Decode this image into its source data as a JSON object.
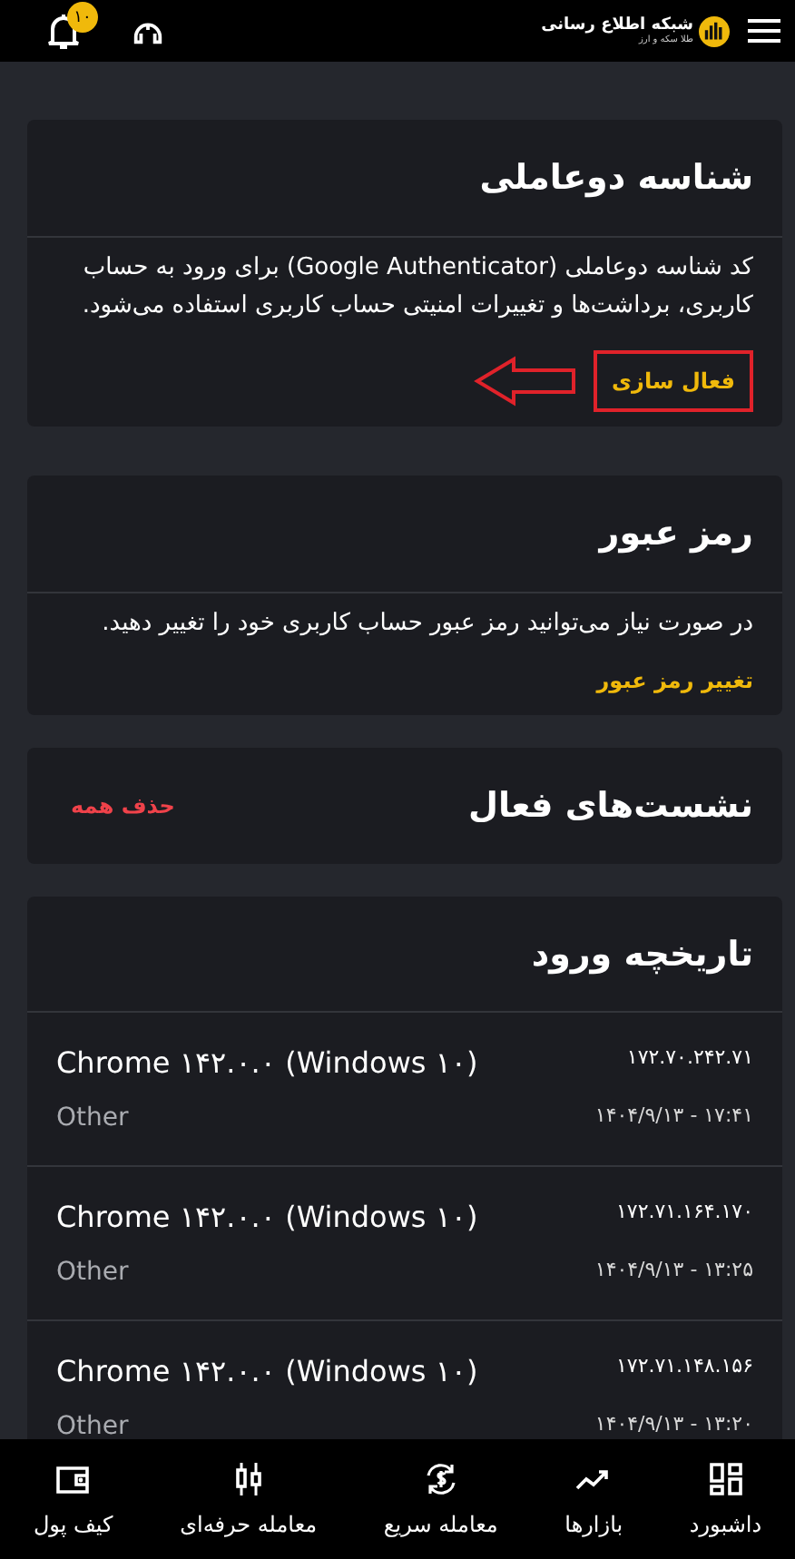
{
  "topbar": {
    "logo_title": "شبکه اطلاع رسانی",
    "logo_subtitle": "طلا سکه و ارز",
    "notification_count": "۱۰"
  },
  "two_factor": {
    "title": "شناسه دوعاملی",
    "description": "کد شناسه دوعاملی (Google Authenticator) برای ورود به حساب کاربری، برداشت‌ها و تغییرات امنیتی حساب کاربری استفاده می‌شود.",
    "action": "فعال سازی",
    "highlighted": true
  },
  "password": {
    "title": "رمز عبور",
    "description": "در صورت نیاز می‌توانید رمز عبور حساب کاربری خود را تغییر دهید.",
    "action": "تغییر رمز عبور"
  },
  "sessions": {
    "title": "نشست‌های فعال",
    "action": "حذف همه"
  },
  "login_history": {
    "title": "تاریخچه ورود",
    "rows": [
      {
        "browser": "Chrome ۱۴۲.۰.۰ (Windows ۱۰)",
        "device": "Other",
        "ip": "۱۷۲.۷۰.۲۴۲.۷۱",
        "time": "۱۴۰۴/۹/۱۳ - ۱۷:۴۱"
      },
      {
        "browser": "Chrome ۱۴۲.۰.۰ (Windows ۱۰)",
        "device": "Other",
        "ip": "۱۷۲.۷۱.۱۶۴.۱۷۰",
        "time": "۱۴۰۴/۹/۱۳ - ۱۳:۲۵"
      },
      {
        "browser": "Chrome ۱۴۲.۰.۰ (Windows ۱۰)",
        "device": "Other",
        "ip": "۱۷۲.۷۱.۱۴۸.۱۵۶",
        "time": "۱۴۰۴/۹/۱۳ - ۱۳:۲۰"
      }
    ]
  },
  "bottom_nav": [
    {
      "label": "داشبورد",
      "kind": "dashboard"
    },
    {
      "label": "بازارها",
      "kind": "markets"
    },
    {
      "label": "معامله سریع",
      "kind": "exchange"
    },
    {
      "label": "معامله حرفه‌ای",
      "kind": "candles"
    },
    {
      "label": "کیف پول",
      "kind": "wallet"
    }
  ]
}
